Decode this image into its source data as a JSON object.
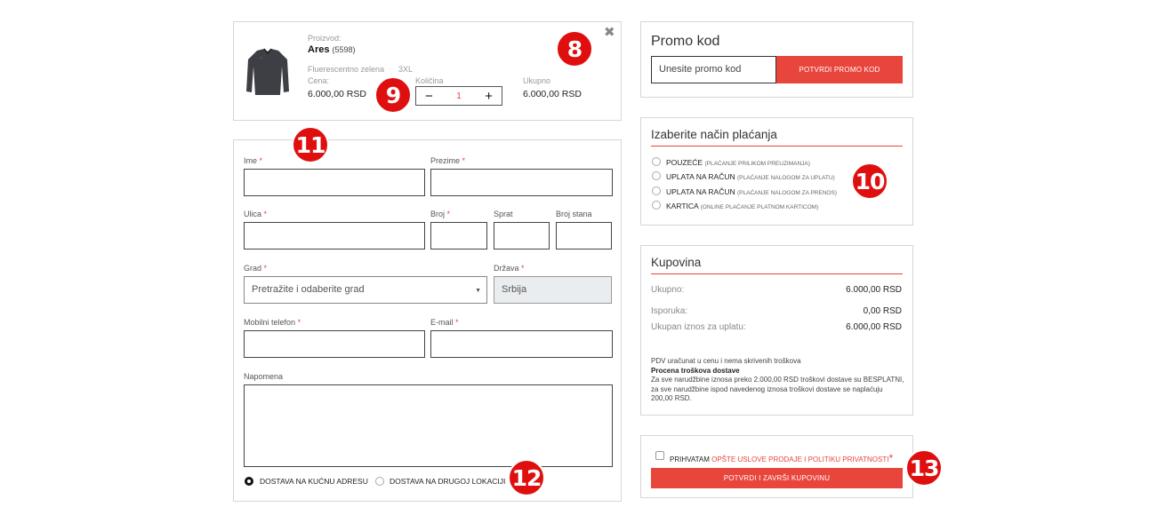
{
  "product": {
    "section_label": "Proizvod:",
    "name": "Ares",
    "code": "(5598)",
    "color": "Fluerescentno zelena",
    "size": "3XL",
    "price_label": "Cena:",
    "price": "6.000,00 RSD",
    "qty_label": "Količina",
    "qty_minus": "−",
    "qty_value": "1",
    "qty_plus": "+",
    "total_label": "Ukupno",
    "total": "6.000,00 RSD",
    "close": "✖"
  },
  "form": {
    "first_name_label": "Ime",
    "last_name_label": "Prezime",
    "street_label": "Ulica",
    "number_label": "Broj",
    "floor_label": "Sprat",
    "apt_label": "Broj stana",
    "city_label": "Grad",
    "city_placeholder": "Pretražite i odaberite grad",
    "country_label": "Država",
    "country_value": "Srbija",
    "phone_label": "Mobilni telefon",
    "email_label": "E-mail",
    "note_label": "Napomena",
    "required_mark": "*",
    "delivery_home": "DOSTAVA NA KUĆNU ADRESU",
    "delivery_other": "DOSTAVA NA DRUGOJ LOKACIJI"
  },
  "promo": {
    "title": "Promo kod",
    "placeholder": "Unesite promo kod",
    "button": "POTVRDI PROMO KOD"
  },
  "payment": {
    "title": "Izaberite način plaćanja",
    "options": [
      {
        "label": "POUZEĆE",
        "sub": "(PLAĆANJE PRILIKOM PREUZIMANJA)"
      },
      {
        "label": "UPLATA NA RAČUN",
        "sub": "(PLAĆANJE NALOGOM ZA UPLATU)"
      },
      {
        "label": "UPLATA NA RAČUN",
        "sub": "(PLAĆANJE NALOGOM ZA PRENOS)"
      },
      {
        "label": "KARTICA",
        "sub": "(ONLINE PLAĆANJE PLATNOM KARTICOM)"
      }
    ]
  },
  "summary": {
    "title": "Kupovina",
    "total_label": "Ukupno:",
    "total_value": "6.000,00 RSD",
    "shipping_label": "Isporuka:",
    "shipping_value": "0,00 RSD",
    "grand_label": "Ukupan iznos za uplatu:",
    "grand_value": "6.000,00 RSD",
    "vat_note": "PDV uračunat u cenu i nema skrivenih troškova",
    "ship_est_title": "Procena troškova dostave",
    "ship_est_text": "Za sve narudžbine iznosa preko 2.000,00 RSD troškovi dostave su BESPLATNI, za sve narudžbine ispod navedenog iznosa troškovi dostave se naplaćuju 200,00 RSD."
  },
  "terms": {
    "accept": "PRIHVATAM",
    "link": "OPŠTE USLOVE PRODAJE I POLITIKU PRIVATNOSTI",
    "star": "*",
    "button": "POTVRDI I ZAVRŠI KUPOVINU"
  },
  "markers": {
    "m8": "8",
    "m9": "9",
    "m10": "10",
    "m11": "11",
    "m12": "12",
    "m13": "13"
  },
  "colors": {
    "accent": "#e8453c",
    "marker": "#e00f0f"
  }
}
